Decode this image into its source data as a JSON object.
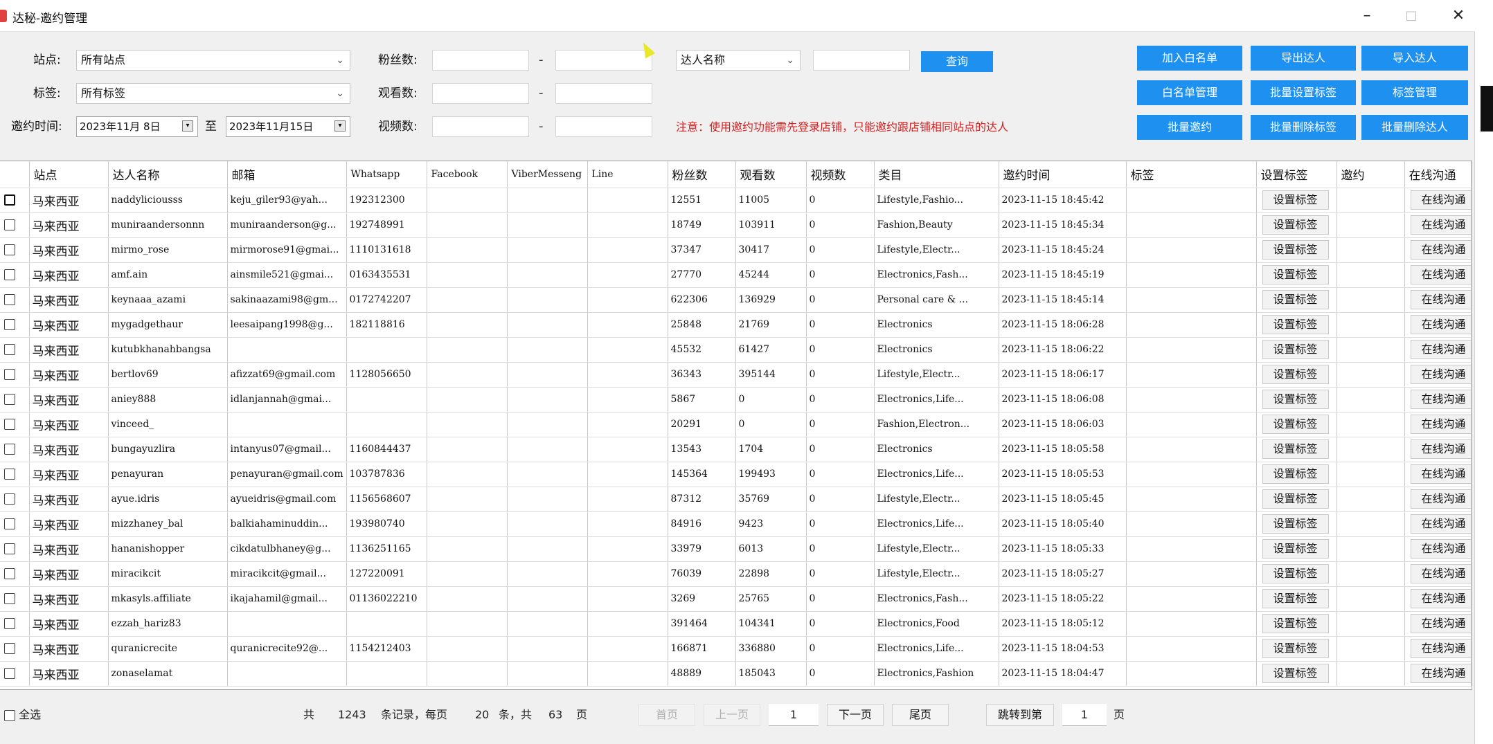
{
  "window": {
    "title": "达秘-邀约管理",
    "minimize": "–",
    "maximize": "□",
    "close": "✕"
  },
  "filters": {
    "site_label": "站点:",
    "site_value": "所有站点",
    "tag_label": "标签:",
    "tag_value": "所有标签",
    "invite_time_label": "邀约时间:",
    "date_from": "2023年11月 8日",
    "date_to_label": "至",
    "date_to": "2023年11月15日",
    "fans_label": "粉丝数:",
    "views_label": "观看数:",
    "videos_label": "视频数:",
    "range_sep": "-",
    "name_select": "达人名称",
    "query_button": "查询",
    "notice": "注意：使用邀约功能需先登录店铺，只能邀约跟店铺相同站点的达人"
  },
  "actions": {
    "add_whitelist": "加入白名单",
    "export": "导出达人",
    "import": "导入达人",
    "whitelist_manage": "白名单管理",
    "batch_set_tags": "批量设置标签",
    "tag_manage": "标签管理",
    "batch_invite": "批量邀约",
    "batch_delete_tags": "批量删除标签",
    "batch_delete": "批量删除达人"
  },
  "table": {
    "columns": [
      "",
      "站点",
      "达人名称",
      "邮箱",
      "Whatsapp",
      "Facebook",
      "ViberMesseng",
      "Line",
      "粉丝数",
      "观看数",
      "视频数",
      "类目",
      "邀约时间",
      "标签",
      "设置标签",
      "邀约",
      "在线沟通"
    ],
    "set_tag_label": "设置标签",
    "chat_label": "在线沟通",
    "rows": [
      {
        "site": "马来西亚",
        "name": "naddyliciousss",
        "email": "keju_giler93@yah...",
        "whatsapp": "192312300",
        "fans": "12551",
        "views": "11005",
        "videos": "0",
        "category": "Lifestyle,Fashio...",
        "time": "2023-11-15 18:45:42"
      },
      {
        "site": "马来西亚",
        "name": "muniraandersonnn",
        "email": "muniraanderson@g...",
        "whatsapp": "192748991",
        "fans": "18749",
        "views": "103911",
        "videos": "0",
        "category": "Fashion,Beauty",
        "time": "2023-11-15 18:45:34"
      },
      {
        "site": "马来西亚",
        "name": "mirmo_rose",
        "email": "mirmorose91@gmai...",
        "whatsapp": "1110131618",
        "fans": "37347",
        "views": "30417",
        "videos": "0",
        "category": "Lifestyle,Electr...",
        "time": "2023-11-15 18:45:24"
      },
      {
        "site": "马来西亚",
        "name": "amf.ain",
        "email": "ainsmile521@gmai...",
        "whatsapp": "0163435531",
        "fans": "27770",
        "views": "45244",
        "videos": "0",
        "category": "Electronics,Fash...",
        "time": "2023-11-15 18:45:19"
      },
      {
        "site": "马来西亚",
        "name": "keynaaa_azami",
        "email": "sakinaazami98@gm...",
        "whatsapp": "0172742207",
        "fans": "622306",
        "views": "136929",
        "videos": "0",
        "category": "Personal care & ...",
        "time": "2023-11-15 18:45:14"
      },
      {
        "site": "马来西亚",
        "name": "mygadgethaur",
        "email": "leesaipang1998@g...",
        "whatsapp": "182118816",
        "fans": "25848",
        "views": "21769",
        "videos": "0",
        "category": "Electronics",
        "time": "2023-11-15 18:06:28"
      },
      {
        "site": "马来西亚",
        "name": "kutubkhanahbangsa",
        "email": "",
        "whatsapp": "",
        "fans": "45532",
        "views": "61427",
        "videos": "0",
        "category": "Electronics",
        "time": "2023-11-15 18:06:22"
      },
      {
        "site": "马来西亚",
        "name": "bertlov69",
        "email": "afizzat69@gmail.com",
        "whatsapp": "1128056650",
        "fans": "36343",
        "views": "395144",
        "videos": "0",
        "category": "Lifestyle,Electr...",
        "time": "2023-11-15 18:06:17"
      },
      {
        "site": "马来西亚",
        "name": "aniey888",
        "email": "idlanjannah@gmai...",
        "whatsapp": "",
        "fans": "5867",
        "views": "0",
        "videos": "0",
        "category": "Electronics,Life...",
        "time": "2023-11-15 18:06:08"
      },
      {
        "site": "马来西亚",
        "name": "vinceed_",
        "email": "",
        "whatsapp": "",
        "fans": "20291",
        "views": "0",
        "videos": "0",
        "category": "Fashion,Electron...",
        "time": "2023-11-15 18:06:03"
      },
      {
        "site": "马来西亚",
        "name": "bungayuzlira",
        "email": "intanyus07@gmail...",
        "whatsapp": "1160844437",
        "fans": "13543",
        "views": "1704",
        "videos": "0",
        "category": "Electronics",
        "time": "2023-11-15 18:05:58"
      },
      {
        "site": "马来西亚",
        "name": "penayuran",
        "email": "penayuran@gmail.com",
        "whatsapp": "103787836",
        "fans": "145364",
        "views": "199493",
        "videos": "0",
        "category": "Electronics,Life...",
        "time": "2023-11-15 18:05:53"
      },
      {
        "site": "马来西亚",
        "name": "ayue.idris",
        "email": "ayueidris@gmail.com",
        "whatsapp": "1156568607",
        "fans": "87312",
        "views": "35769",
        "videos": "0",
        "category": "Lifestyle,Electr...",
        "time": "2023-11-15 18:05:45"
      },
      {
        "site": "马来西亚",
        "name": "mizzhaney_bal",
        "email": "balkiahaminuddin...",
        "whatsapp": "193980740",
        "fans": "84916",
        "views": "9423",
        "videos": "0",
        "category": "Electronics,Life...",
        "time": "2023-11-15 18:05:40"
      },
      {
        "site": "马来西亚",
        "name": "hananishopper",
        "email": "cikdatulbhaney@g...",
        "whatsapp": "1136251165",
        "fans": "33979",
        "views": "6013",
        "videos": "0",
        "category": "Lifestyle,Electr...",
        "time": "2023-11-15 18:05:33"
      },
      {
        "site": "马来西亚",
        "name": "miracikcit",
        "email": "miracikcit@gmail...",
        "whatsapp": "127220091",
        "fans": "76039",
        "views": "22898",
        "videos": "0",
        "category": "Lifestyle,Electr...",
        "time": "2023-11-15 18:05:27"
      },
      {
        "site": "马来西亚",
        "name": "mkasyls.affiliate",
        "email": "ikajahamil@gmail...",
        "whatsapp": "01136022210",
        "fans": "3269",
        "views": "25765",
        "videos": "0",
        "category": "Electronics,Fash...",
        "time": "2023-11-15 18:05:22"
      },
      {
        "site": "马来西亚",
        "name": "ezzah_hariz83",
        "email": "",
        "whatsapp": "",
        "fans": "391464",
        "views": "104341",
        "videos": "0",
        "category": "Electronics,Food",
        "time": "2023-11-15 18:05:12"
      },
      {
        "site": "马来西亚",
        "name": "quranicrecite",
        "email": "quranicrecite92@...",
        "whatsapp": "1154212403",
        "fans": "166871",
        "views": "336880",
        "videos": "0",
        "category": "Electronics,Life...",
        "time": "2023-11-15 18:04:53"
      },
      {
        "site": "马来西亚",
        "name": "zonaselamat",
        "email": "",
        "whatsapp": "",
        "fans": "48889",
        "views": "185043",
        "videos": "0",
        "category": "Electronics,Fashion",
        "time": "2023-11-15 18:04:47"
      }
    ]
  },
  "footer": {
    "select_all": "全选",
    "total_prefix": "共",
    "total": "1243",
    "records_per_page": "条记录，每页",
    "page_size": "20",
    "pages_prefix": "条，共",
    "pages": "63",
    "page_unit": "页",
    "first": "首页",
    "prev": "上一页",
    "current": "1",
    "next": "下一页",
    "last": "尾页",
    "jump": "跳转到第",
    "jump_value": "1",
    "jump_unit": "页"
  }
}
